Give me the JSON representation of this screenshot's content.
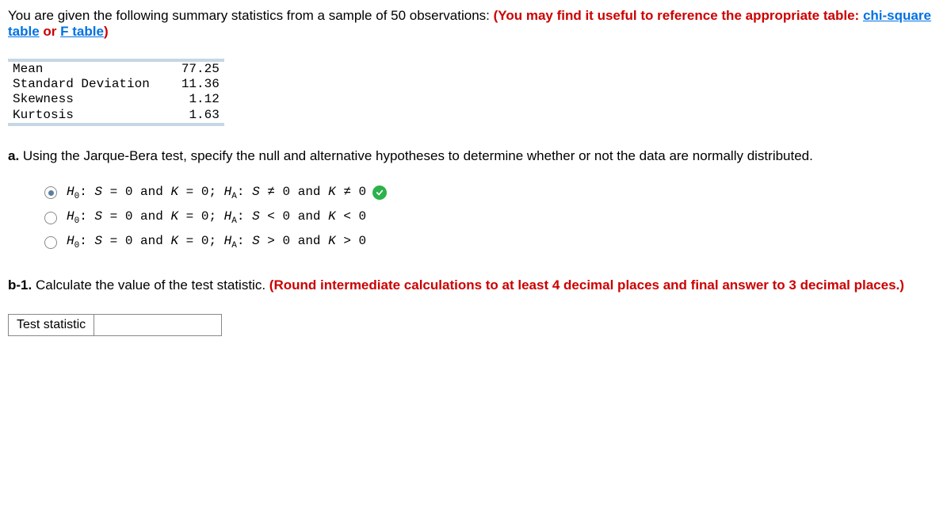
{
  "intro": {
    "text": "You are given the following summary statistics from a sample of 50 observations: ",
    "hint_prefix": "(You may find it useful to reference the appropriate table: ",
    "link1": "chi-square table",
    "or": " or ",
    "link2": "F table",
    "hint_suffix": ")"
  },
  "stats": {
    "rows": [
      {
        "label": "Mean",
        "value": "77.25"
      },
      {
        "label": "Standard Deviation",
        "value": "11.36"
      },
      {
        "label": "Skewness",
        "value": "1.12"
      },
      {
        "label": "Kurtosis",
        "value": "1.63"
      }
    ]
  },
  "part_a": {
    "label": "a.",
    "text": " Using the Jarque-Bera test, specify the null and alternative hypotheses to determine whether or not the data are normally distributed."
  },
  "options": [
    {
      "selected": true,
      "correct": true,
      "null_rel": " = 0",
      "alt_rel_s": " ≠ 0",
      "alt_rel_k": " ≠ 0"
    },
    {
      "selected": false,
      "correct": false,
      "null_rel": " = 0",
      "alt_rel_s": " < 0",
      "alt_rel_k": " < 0"
    },
    {
      "selected": false,
      "correct": false,
      "null_rel": " = 0",
      "alt_rel_s": " > 0",
      "alt_rel_k": " > 0"
    }
  ],
  "labels": {
    "H": "H",
    "sub0": "0",
    "subA": "A",
    "S": "S",
    "K": "K",
    "and": " and ",
    "colon_sp": ": ",
    "semicolon_sp": "; "
  },
  "part_b1": {
    "label": "b-1.",
    "text": " Calculate the value of the test statistic. ",
    "hint": "(Round intermediate calculations to at least 4 decimal places and final answer to 3 decimal places.)"
  },
  "answer": {
    "label": "Test statistic",
    "value": ""
  }
}
